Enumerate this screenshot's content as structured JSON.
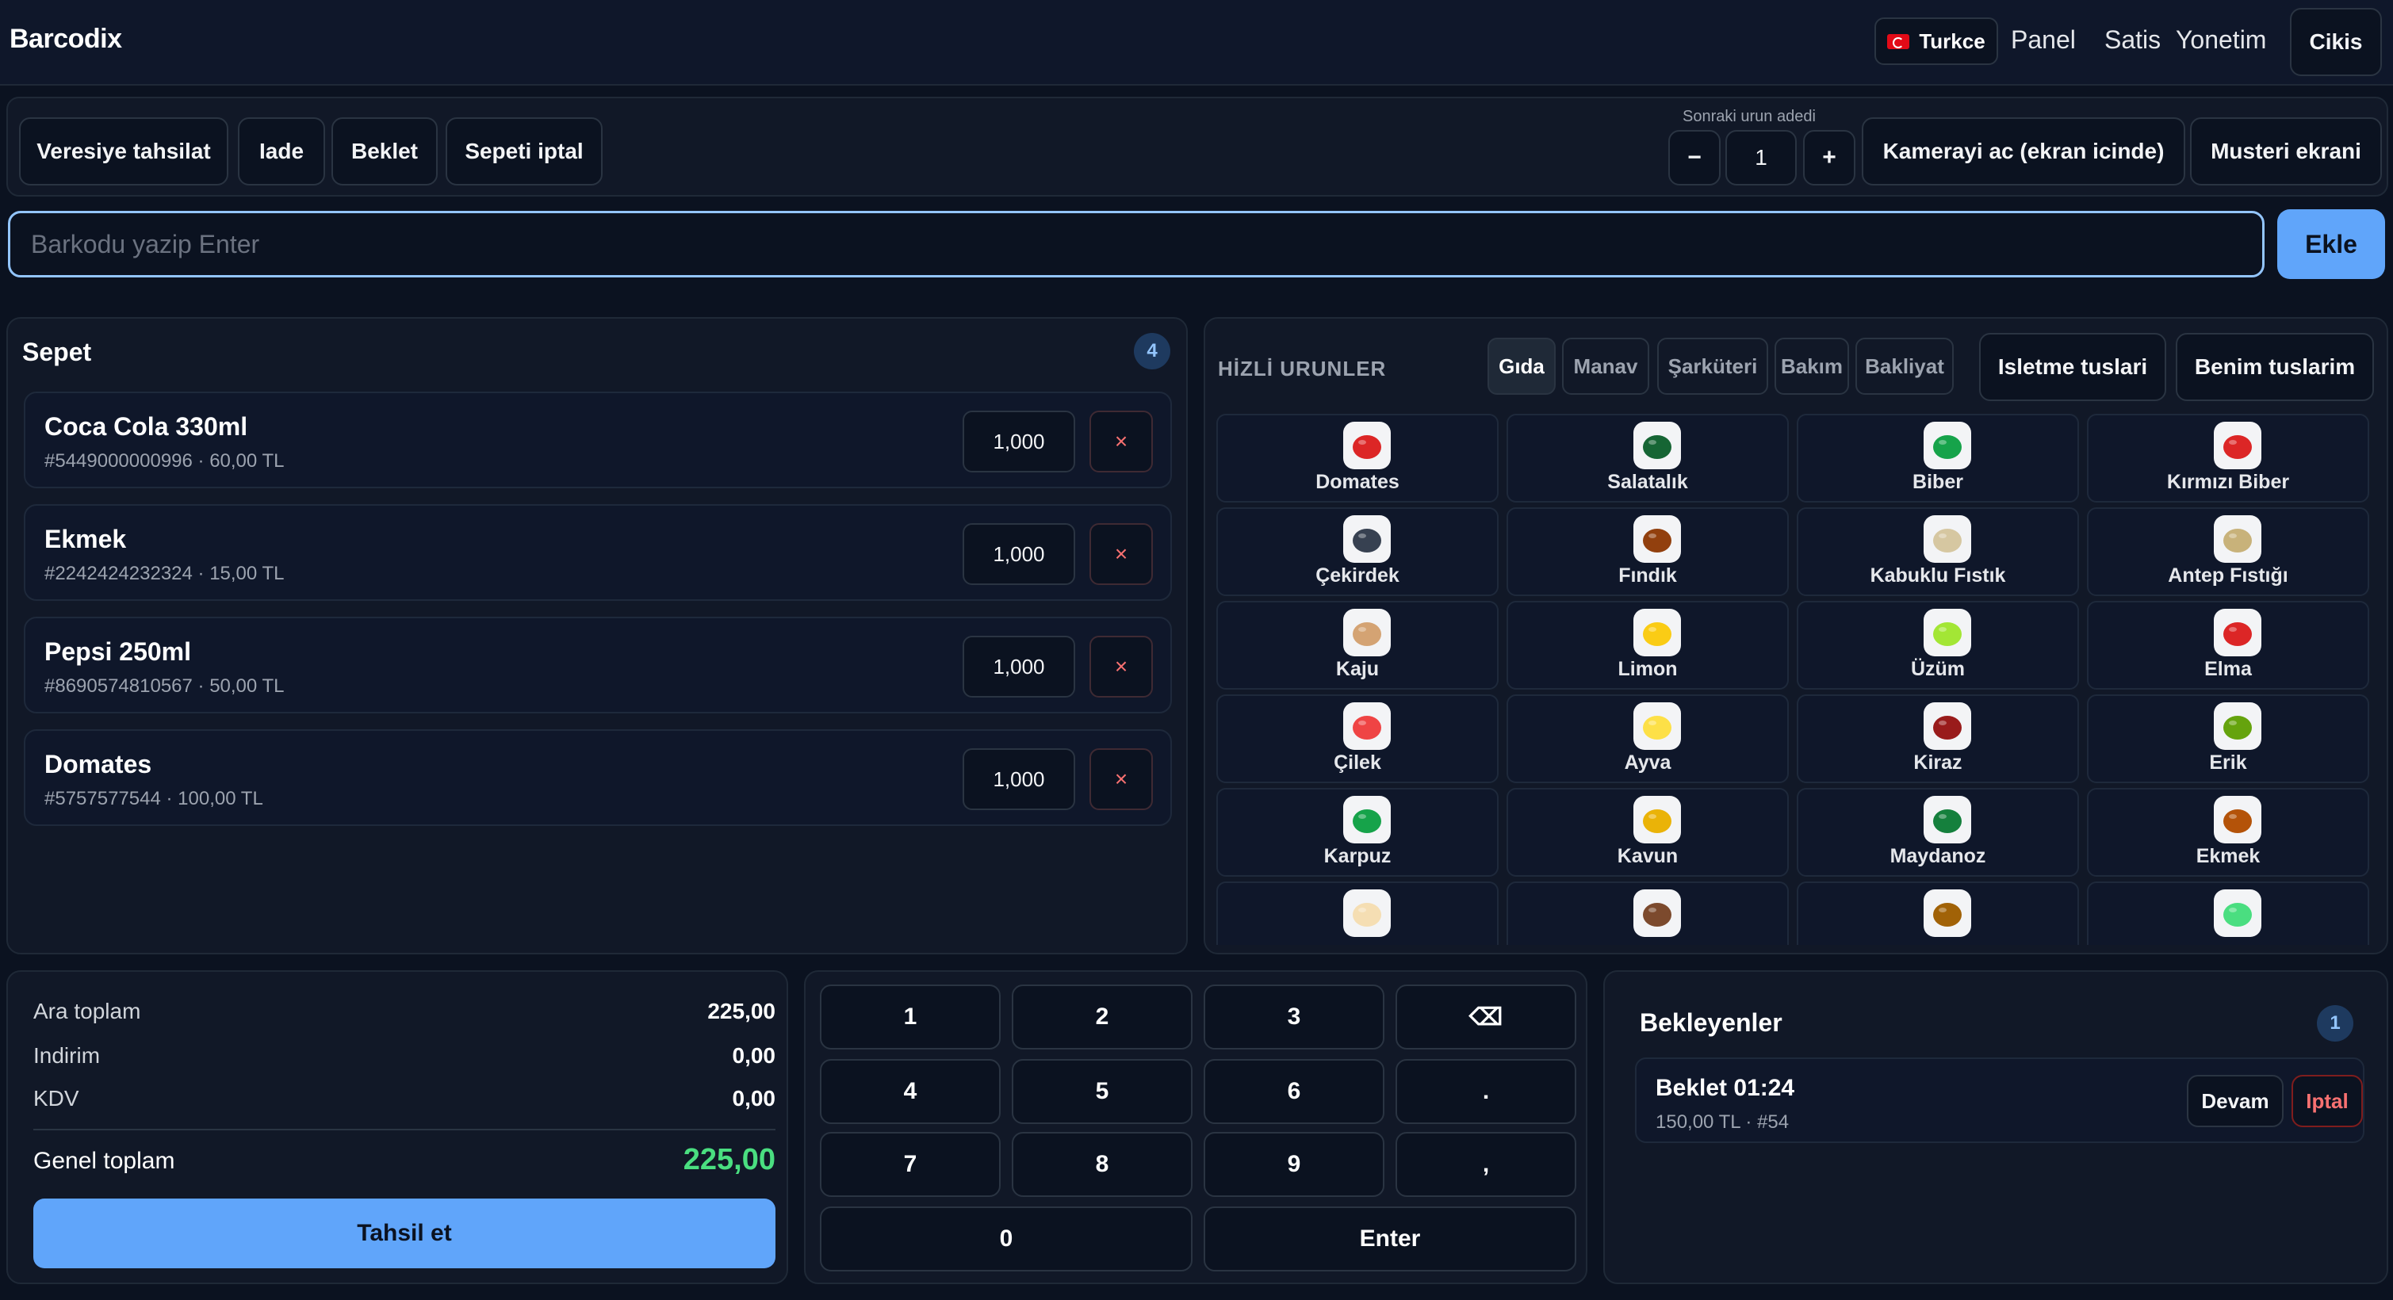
{
  "app": {
    "brand": "Barcodix"
  },
  "nav": {
    "language": "Turkce",
    "panel": "Panel",
    "satis": "Satis",
    "yonetim": "Yonetim",
    "cikis": "Cikis"
  },
  "toolbar": {
    "veresiye": "Veresiye tahsilat",
    "iade": "Iade",
    "beklet": "Beklet",
    "sepeti_iptal": "Sepeti iptal",
    "next_qty_label": "Sonraki urun adedi",
    "minus": "−",
    "next_qty": "1",
    "plus": "+",
    "camera": "Kamerayi ac (ekran icinde)",
    "customer_screen": "Musteri ekrani"
  },
  "search": {
    "placeholder": "Barkodu yazip Enter",
    "value": "",
    "add_button": "Ekle"
  },
  "cart": {
    "title": "Sepet",
    "count": "4",
    "items": [
      {
        "name": "Coca Cola 330ml",
        "sub": "#5449000000996 · 60,00 TL",
        "qty": "1,000",
        "remove": "×"
      },
      {
        "name": "Ekmek",
        "sub": "#2242424232324 · 15,00 TL",
        "qty": "1,000",
        "remove": "×"
      },
      {
        "name": "Pepsi 250ml",
        "sub": "#8690574810567 · 50,00 TL",
        "qty": "1,000",
        "remove": "×"
      },
      {
        "name": "Domates",
        "sub": "#5757577544 · 100,00 TL",
        "qty": "1,000",
        "remove": "×"
      }
    ]
  },
  "quick": {
    "title": "HİZLİ URUNLER",
    "categories": [
      "Gıda",
      "Manav",
      "Şarküteri",
      "Bakım",
      "Bakliyat"
    ],
    "active_category": "Gıda",
    "isletme": "Isletme tuslari",
    "benim": "Benim tuslarim",
    "products": [
      {
        "label": "Domates",
        "icon": "tomato-icon",
        "color": "#dc2626"
      },
      {
        "label": "Salatalık",
        "icon": "cucumber-icon",
        "color": "#166534"
      },
      {
        "label": "Biber",
        "icon": "green-pepper-icon",
        "color": "#16a34a"
      },
      {
        "label": "Kırmızı Biber",
        "icon": "red-pepper-icon",
        "color": "#dc2626"
      },
      {
        "label": "Çekirdek",
        "icon": "seeds-icon",
        "color": "#374151"
      },
      {
        "label": "Fındık",
        "icon": "hazelnut-icon",
        "color": "#92400e"
      },
      {
        "label": "Kabuklu Fıstık",
        "icon": "peanut-icon",
        "color": "#d6c7a1"
      },
      {
        "label": "Antep Fıstığı",
        "icon": "pistachio-icon",
        "color": "#c8b27a"
      },
      {
        "label": "Kaju",
        "icon": "cashew-icon",
        "color": "#d4a373"
      },
      {
        "label": "Limon",
        "icon": "lemon-icon",
        "color": "#facc15"
      },
      {
        "label": "Üzüm",
        "icon": "grapes-icon",
        "color": "#a3e635"
      },
      {
        "label": "Elma",
        "icon": "apple-icon",
        "color": "#dc2626"
      },
      {
        "label": "Çilek",
        "icon": "strawberry-icon",
        "color": "#ef4444"
      },
      {
        "label": "Ayva",
        "icon": "quince-icon",
        "color": "#fde047"
      },
      {
        "label": "Kiraz",
        "icon": "cherry-icon",
        "color": "#991b1b"
      },
      {
        "label": "Erik",
        "icon": "plum-icon",
        "color": "#65a30d"
      },
      {
        "label": "Karpuz",
        "icon": "watermelon-icon",
        "color": "#16a34a"
      },
      {
        "label": "Kavun",
        "icon": "melon-icon",
        "color": "#eab308"
      },
      {
        "label": "Maydanoz",
        "icon": "parsley-icon",
        "color": "#15803d"
      },
      {
        "label": "Ekmek",
        "icon": "bread-icon",
        "color": "#b45309"
      },
      {
        "label": "",
        "icon": "toast-bread-icon",
        "color": "#f5deb3"
      },
      {
        "label": "",
        "icon": "baguette-icon",
        "color": "#7c4a2d"
      },
      {
        "label": "",
        "icon": "cookie-icon",
        "color": "#a16207"
      },
      {
        "label": "",
        "icon": "green-apple-icon",
        "color": "#4ade80"
      }
    ]
  },
  "summary": {
    "ara_toplam_label": "Ara toplam",
    "ara_toplam": "225,00",
    "indirim_label": "Indirim",
    "indirim": "0,00",
    "kdv_label": "KDV",
    "kdv": "0,00",
    "genel_label": "Genel toplam",
    "genel": "225,00",
    "pay_button": "Tahsil et"
  },
  "keypad": {
    "keys": [
      "1",
      "2",
      "3",
      "⌫",
      "4",
      "5",
      "6",
      ".",
      "7",
      "8",
      "9",
      ",",
      "0",
      "Enter"
    ]
  },
  "waiting": {
    "title": "Bekleyenler",
    "count": "1",
    "items": [
      {
        "name": "Beklet 01:24",
        "sub": "150,00 TL · #54",
        "resume": "Devam",
        "cancel": "Iptal"
      }
    ]
  },
  "colors": {
    "accent": "#60a5fa",
    "total_green": "#4ade80",
    "danger": "#f87171",
    "background": "#0b1220"
  }
}
